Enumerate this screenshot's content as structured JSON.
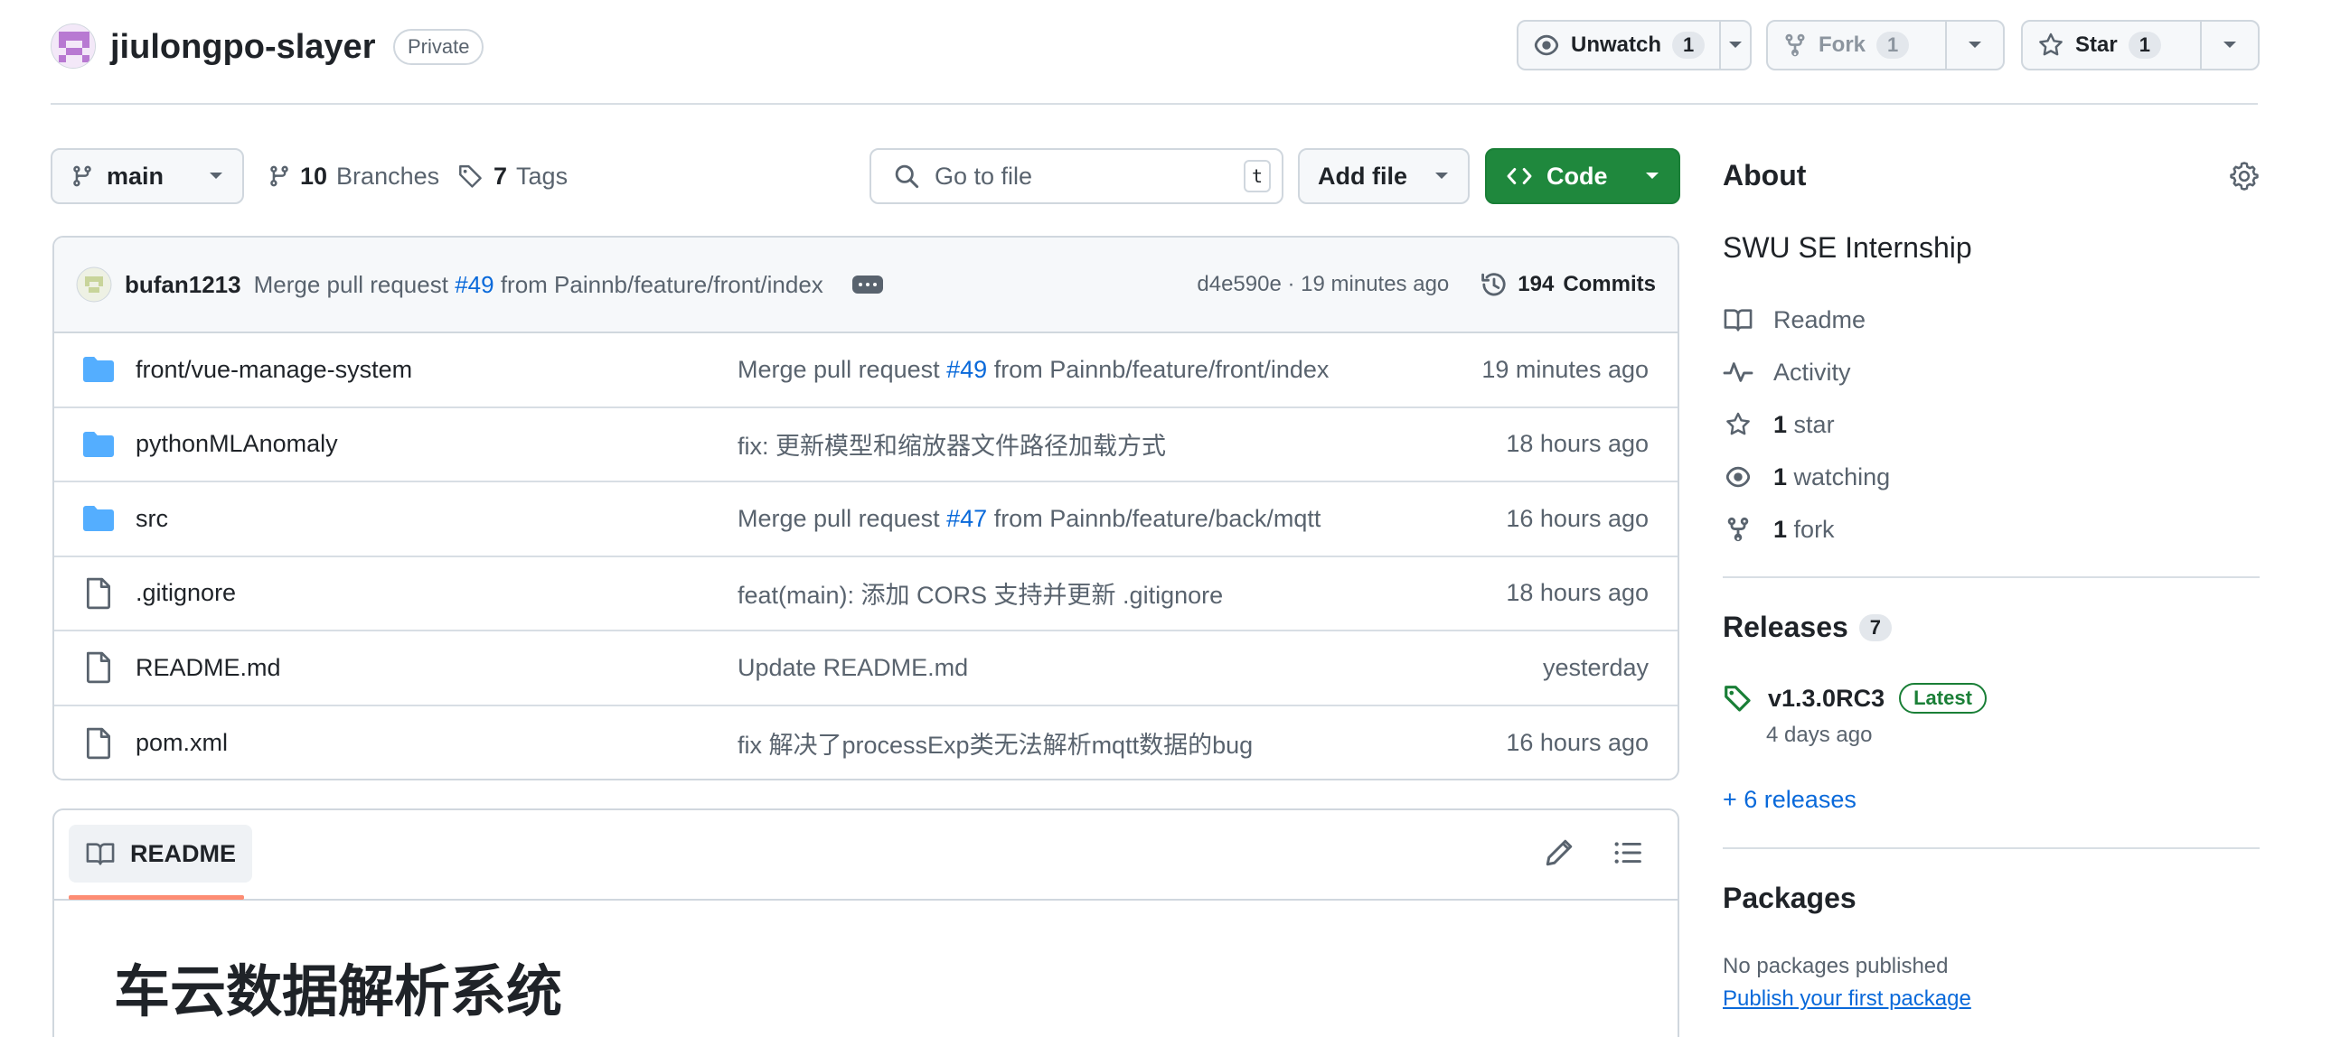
{
  "repo": {
    "name": "jiulongpo-slayer",
    "visibility": "Private"
  },
  "header_actions": {
    "watch": {
      "label": "Unwatch",
      "count": "1"
    },
    "fork": {
      "label": "Fork",
      "count": "1"
    },
    "star": {
      "label": "Star",
      "count": "1"
    }
  },
  "toolbar": {
    "branch": "main",
    "branches_count": "10",
    "branches_label": "Branches",
    "tags_count": "7",
    "tags_label": "Tags",
    "goto_placeholder": "Go to file",
    "goto_shortcut": "t",
    "add_file": "Add file",
    "code": "Code"
  },
  "latest_commit": {
    "author": "bufan1213",
    "message_prefix": "Merge pull request",
    "pr": "#49",
    "message_suffix": "from Painnb/feature/front/index",
    "hash_time": "d4e590e · 19 minutes ago",
    "commits_count": "194",
    "commits_label": "Commits"
  },
  "files": [
    {
      "type": "folder",
      "name": "front/vue-manage-system",
      "msg_prefix": "Merge pull request ",
      "msg_link": "#49",
      "msg_suffix": " from Painnb/feature/front/index",
      "time": "19 minutes ago"
    },
    {
      "type": "folder",
      "name": "pythonMLAnomaly",
      "msg_prefix": "fix: 更新模型和缩放器文件路径加载方式",
      "msg_link": "",
      "msg_suffix": "",
      "time": "18 hours ago"
    },
    {
      "type": "folder",
      "name": "src",
      "msg_prefix": "Merge pull request ",
      "msg_link": "#47",
      "msg_suffix": " from Painnb/feature/back/mqtt",
      "time": "16 hours ago"
    },
    {
      "type": "file",
      "name": ".gitignore",
      "msg_prefix": "feat(main): 添加 CORS 支持并更新 .gitignore",
      "msg_link": "",
      "msg_suffix": "",
      "time": "18 hours ago"
    },
    {
      "type": "file",
      "name": "README.md",
      "msg_prefix": "Update README.md",
      "msg_link": "",
      "msg_suffix": "",
      "time": "yesterday"
    },
    {
      "type": "file",
      "name": "pom.xml",
      "msg_prefix": "fix 解决了processExp类无法解析mqtt数据的bug",
      "msg_link": "",
      "msg_suffix": "",
      "time": "16 hours ago"
    }
  ],
  "readme": {
    "tab": "README",
    "title": "车云数据解析系统"
  },
  "about": {
    "heading": "About",
    "description": "SWU SE Internship",
    "readme": "Readme",
    "activity": "Activity",
    "stars_count": "1",
    "stars_label": "star",
    "watching_count": "1",
    "watching_label": "watching",
    "forks_count": "1",
    "forks_label": "fork"
  },
  "releases": {
    "heading": "Releases",
    "count": "7",
    "latest_tag": "v1.3.0RC3",
    "latest_badge": "Latest",
    "latest_date": "4 days ago",
    "more": "+ 6 releases"
  },
  "packages": {
    "heading": "Packages",
    "empty": "No packages published",
    "publish_link": "Publish your first package"
  },
  "colors": {
    "accent": "#0969da",
    "primary_button": "#1f883d",
    "folder": "#54aeff",
    "readme_tab_underline": "#fd8c73"
  }
}
